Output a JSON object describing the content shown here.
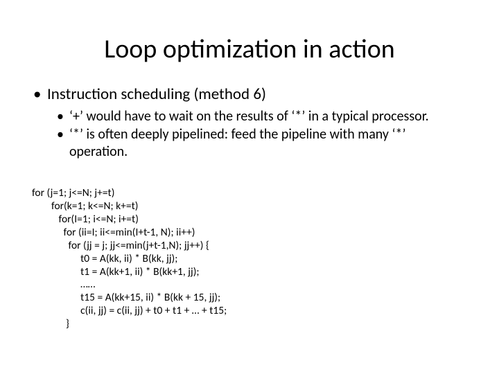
{
  "title": "Loop optimization in action",
  "bullet1": "Instruction scheduling (method 6)",
  "sub1": "‘+’ would have to wait on the results of ‘*’ in a typical processor.",
  "sub2": "‘*’ is often deeply pipelined: feed the pipeline with many ‘*’ operation.",
  "code": {
    "l1": "for (j=1; j<=N; j+=t)",
    "l2": "        for(k=1; k<=N; k+=t)",
    "l3": "           for(I=1; i<=N; i+=t)",
    "l4": "             for (ii=I; ii<=min(I+t-1, N); ii++)",
    "l5": "               for (jj = j; jj<=min(j+t-1,N); jj++) {",
    "l6": "                    t0 = A(kk, ii) * B(kk, jj);",
    "l7": "                    t1 = A(kk+1, ii) * B(kk+1, jj);",
    "l8": "                    ……",
    "l9": "                    t15 = A(kk+15, ii) * B(kk + 15, jj);",
    "l10": "                    c(ii, jj) = c(ii, jj) + t0 + t1 + … + t15;",
    "l11": "              }"
  }
}
